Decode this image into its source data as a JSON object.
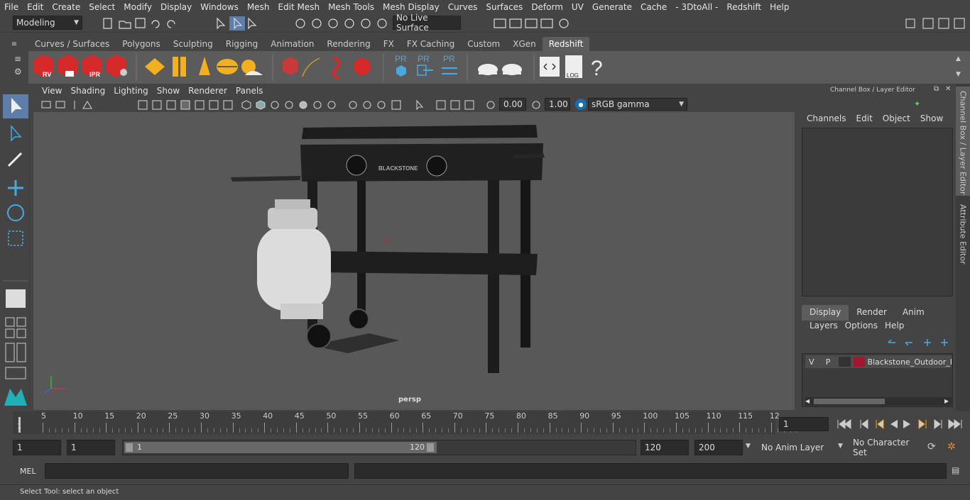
{
  "menubar": [
    "File",
    "Edit",
    "Create",
    "Select",
    "Modify",
    "Display",
    "Windows",
    "Mesh",
    "Edit Mesh",
    "Mesh Tools",
    "Mesh Display",
    "Curves",
    "Surfaces",
    "Deform",
    "UV",
    "Generate",
    "Cache",
    "- 3DtoAll -",
    "Redshift",
    "Help"
  ],
  "statusline": {
    "mode": "Modeling",
    "live_surface": "No Live Surface"
  },
  "shelf_tabs": [
    "Curves / Surfaces",
    "Polygons",
    "Sculpting",
    "Rigging",
    "Animation",
    "Rendering",
    "FX",
    "FX Caching",
    "Custom",
    "XGen",
    "Redshift"
  ],
  "shelf_active": "Redshift",
  "shelf_labels": {
    "rv": "RV",
    "ipr": "IPR",
    "pr1": "PR",
    "pr2": "PR",
    "pr3": "PR",
    "log": "LOG",
    "help": "?"
  },
  "panel_menu": [
    "View",
    "Shading",
    "Lighting",
    "Show",
    "Renderer",
    "Panels"
  ],
  "panel_tools": {
    "exposure": "0.00",
    "gamma": "1.00",
    "color_space": "sRGB gamma"
  },
  "viewport": {
    "camera_label": "persp",
    "product_label": "BLACKSTONE"
  },
  "channel_box": {
    "title": "Channel Box / Layer Editor",
    "menu": [
      "Channels",
      "Edit",
      "Object",
      "Show"
    ],
    "layer_tabs": [
      "Display",
      "Render",
      "Anim"
    ],
    "layer_tab_active": "Display",
    "layer_menu": [
      "Layers",
      "Options",
      "Help"
    ],
    "layer_row": {
      "v": "V",
      "p": "P",
      "name": "Blackstone_Outdoor_F",
      "color": "#a3162f"
    }
  },
  "side_tabs": [
    "Channel Box / Layer Editor",
    "Attribute Editor"
  ],
  "timeline": {
    "ticks": [
      "5",
      "10",
      "15",
      "20",
      "25",
      "30",
      "35",
      "40",
      "45",
      "50",
      "55",
      "60",
      "65",
      "70",
      "75",
      "80",
      "85",
      "90",
      "95",
      "100",
      "105",
      "110",
      "115",
      "12"
    ],
    "start_label": "1",
    "current_frame": "1"
  },
  "range": {
    "start": "1",
    "start2": "1",
    "slider_start": "1",
    "slider_end": "120",
    "end": "120",
    "end2": "200",
    "anim_layer": "No Anim Layer",
    "char_set": "No Character Set"
  },
  "cmdline": {
    "label": "MEL"
  },
  "helpline": {
    "text": "Select Tool: select an object"
  }
}
